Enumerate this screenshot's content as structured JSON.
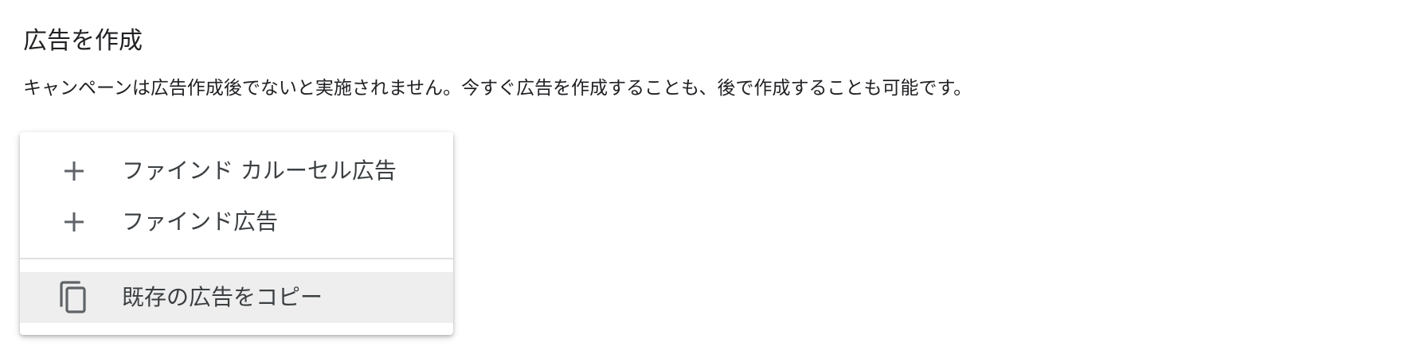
{
  "section": {
    "title": "広告を作成",
    "description": "キャンペーンは広告作成後でないと実施されません。今すぐ広告を作成することも、後で作成することも可能です。"
  },
  "menu": {
    "items": [
      {
        "label": "ファインド カルーセル広告",
        "icon": "plus-icon"
      },
      {
        "label": "ファインド広告",
        "icon": "plus-icon"
      }
    ],
    "copy_item": {
      "label": "既存の広告をコピー",
      "icon": "copy-icon"
    }
  },
  "colors": {
    "text": "#202124",
    "icon": "#5f6368",
    "hover_background": "#eeeeee",
    "divider": "#e0e0e0"
  }
}
